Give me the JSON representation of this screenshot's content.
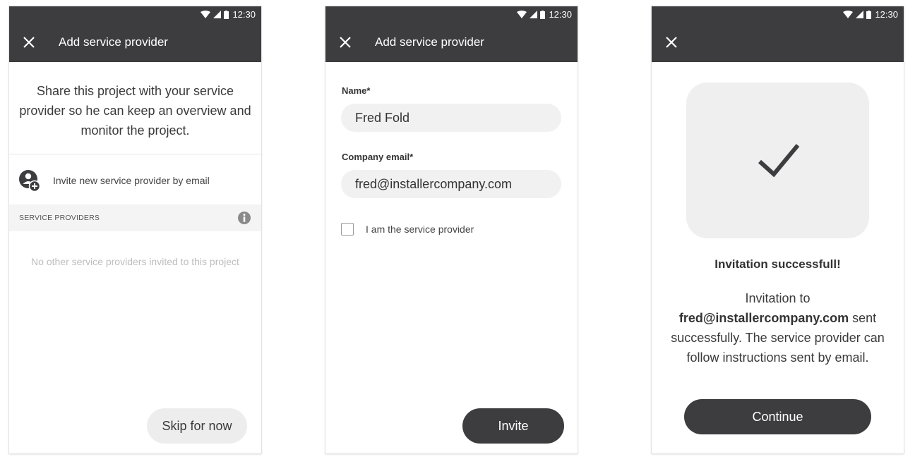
{
  "screens": [
    {
      "status": {
        "time": "12:30"
      },
      "appbar": {
        "title": "Add service provider",
        "close_icon": "close-icon"
      },
      "intro": "Share this project with your service provider so he can keep an overview and monitor the project.",
      "invite_option": {
        "label": "Invite new service provider by email",
        "icon": "add-person-icon"
      },
      "section": {
        "label": "SERVICE PROVIDERS",
        "info_icon": "info-icon"
      },
      "empty_state": "No other service providers invited to this project",
      "skip_button": "Skip for now"
    },
    {
      "status": {
        "time": "12:30"
      },
      "appbar": {
        "title": "Add service provider",
        "close_icon": "close-icon"
      },
      "form": {
        "name_label": "Name*",
        "name_value": "Fred Fold",
        "email_label": "Company email*",
        "email_value": "fred@installercompany.com",
        "checkbox_label": "I am the service provider",
        "checkbox_checked": false
      },
      "invite_button": "Invite"
    },
    {
      "status": {
        "time": "12:30"
      },
      "appbar": {
        "close_icon": "close-icon"
      },
      "success_icon": "checkmark-icon",
      "success_title": "Invitation successfull!",
      "message": {
        "prefix": "Invitation to",
        "email": "fred@installercompany.com",
        "suffix": "sent successfully. The service provider can follow instructions sent by email."
      },
      "continue_button": "Continue"
    }
  ],
  "colors": {
    "bar": "#3d3d40",
    "field_bg": "#f1f1f1",
    "tile_bg": "#efefef",
    "muted_text": "#bdbdbd"
  }
}
